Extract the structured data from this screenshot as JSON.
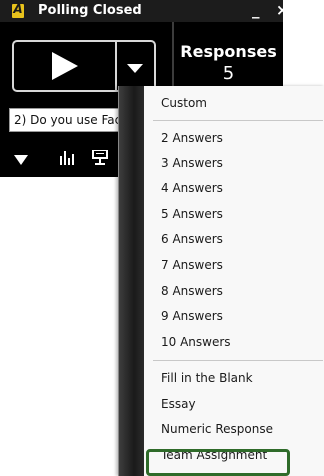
{
  "window": {
    "title": "Polling Closed",
    "minimize": "_",
    "close": "×"
  },
  "responses": {
    "label": "Responses",
    "count": "5"
  },
  "question": {
    "value": "2) Do you use Fac"
  },
  "menu": {
    "items": [
      "Custom",
      "2 Answers",
      "3 Answers",
      "4 Answers",
      "5 Answers",
      "6 Answers",
      "7 Answers",
      "8 Answers",
      "9 Answers",
      "10 Answers",
      "Fill in the Blank",
      "Essay",
      "Numeric Response",
      "Team Assignment"
    ]
  },
  "colors": {
    "highlight": "#2f6b2a",
    "logo": "#e8c21c"
  }
}
